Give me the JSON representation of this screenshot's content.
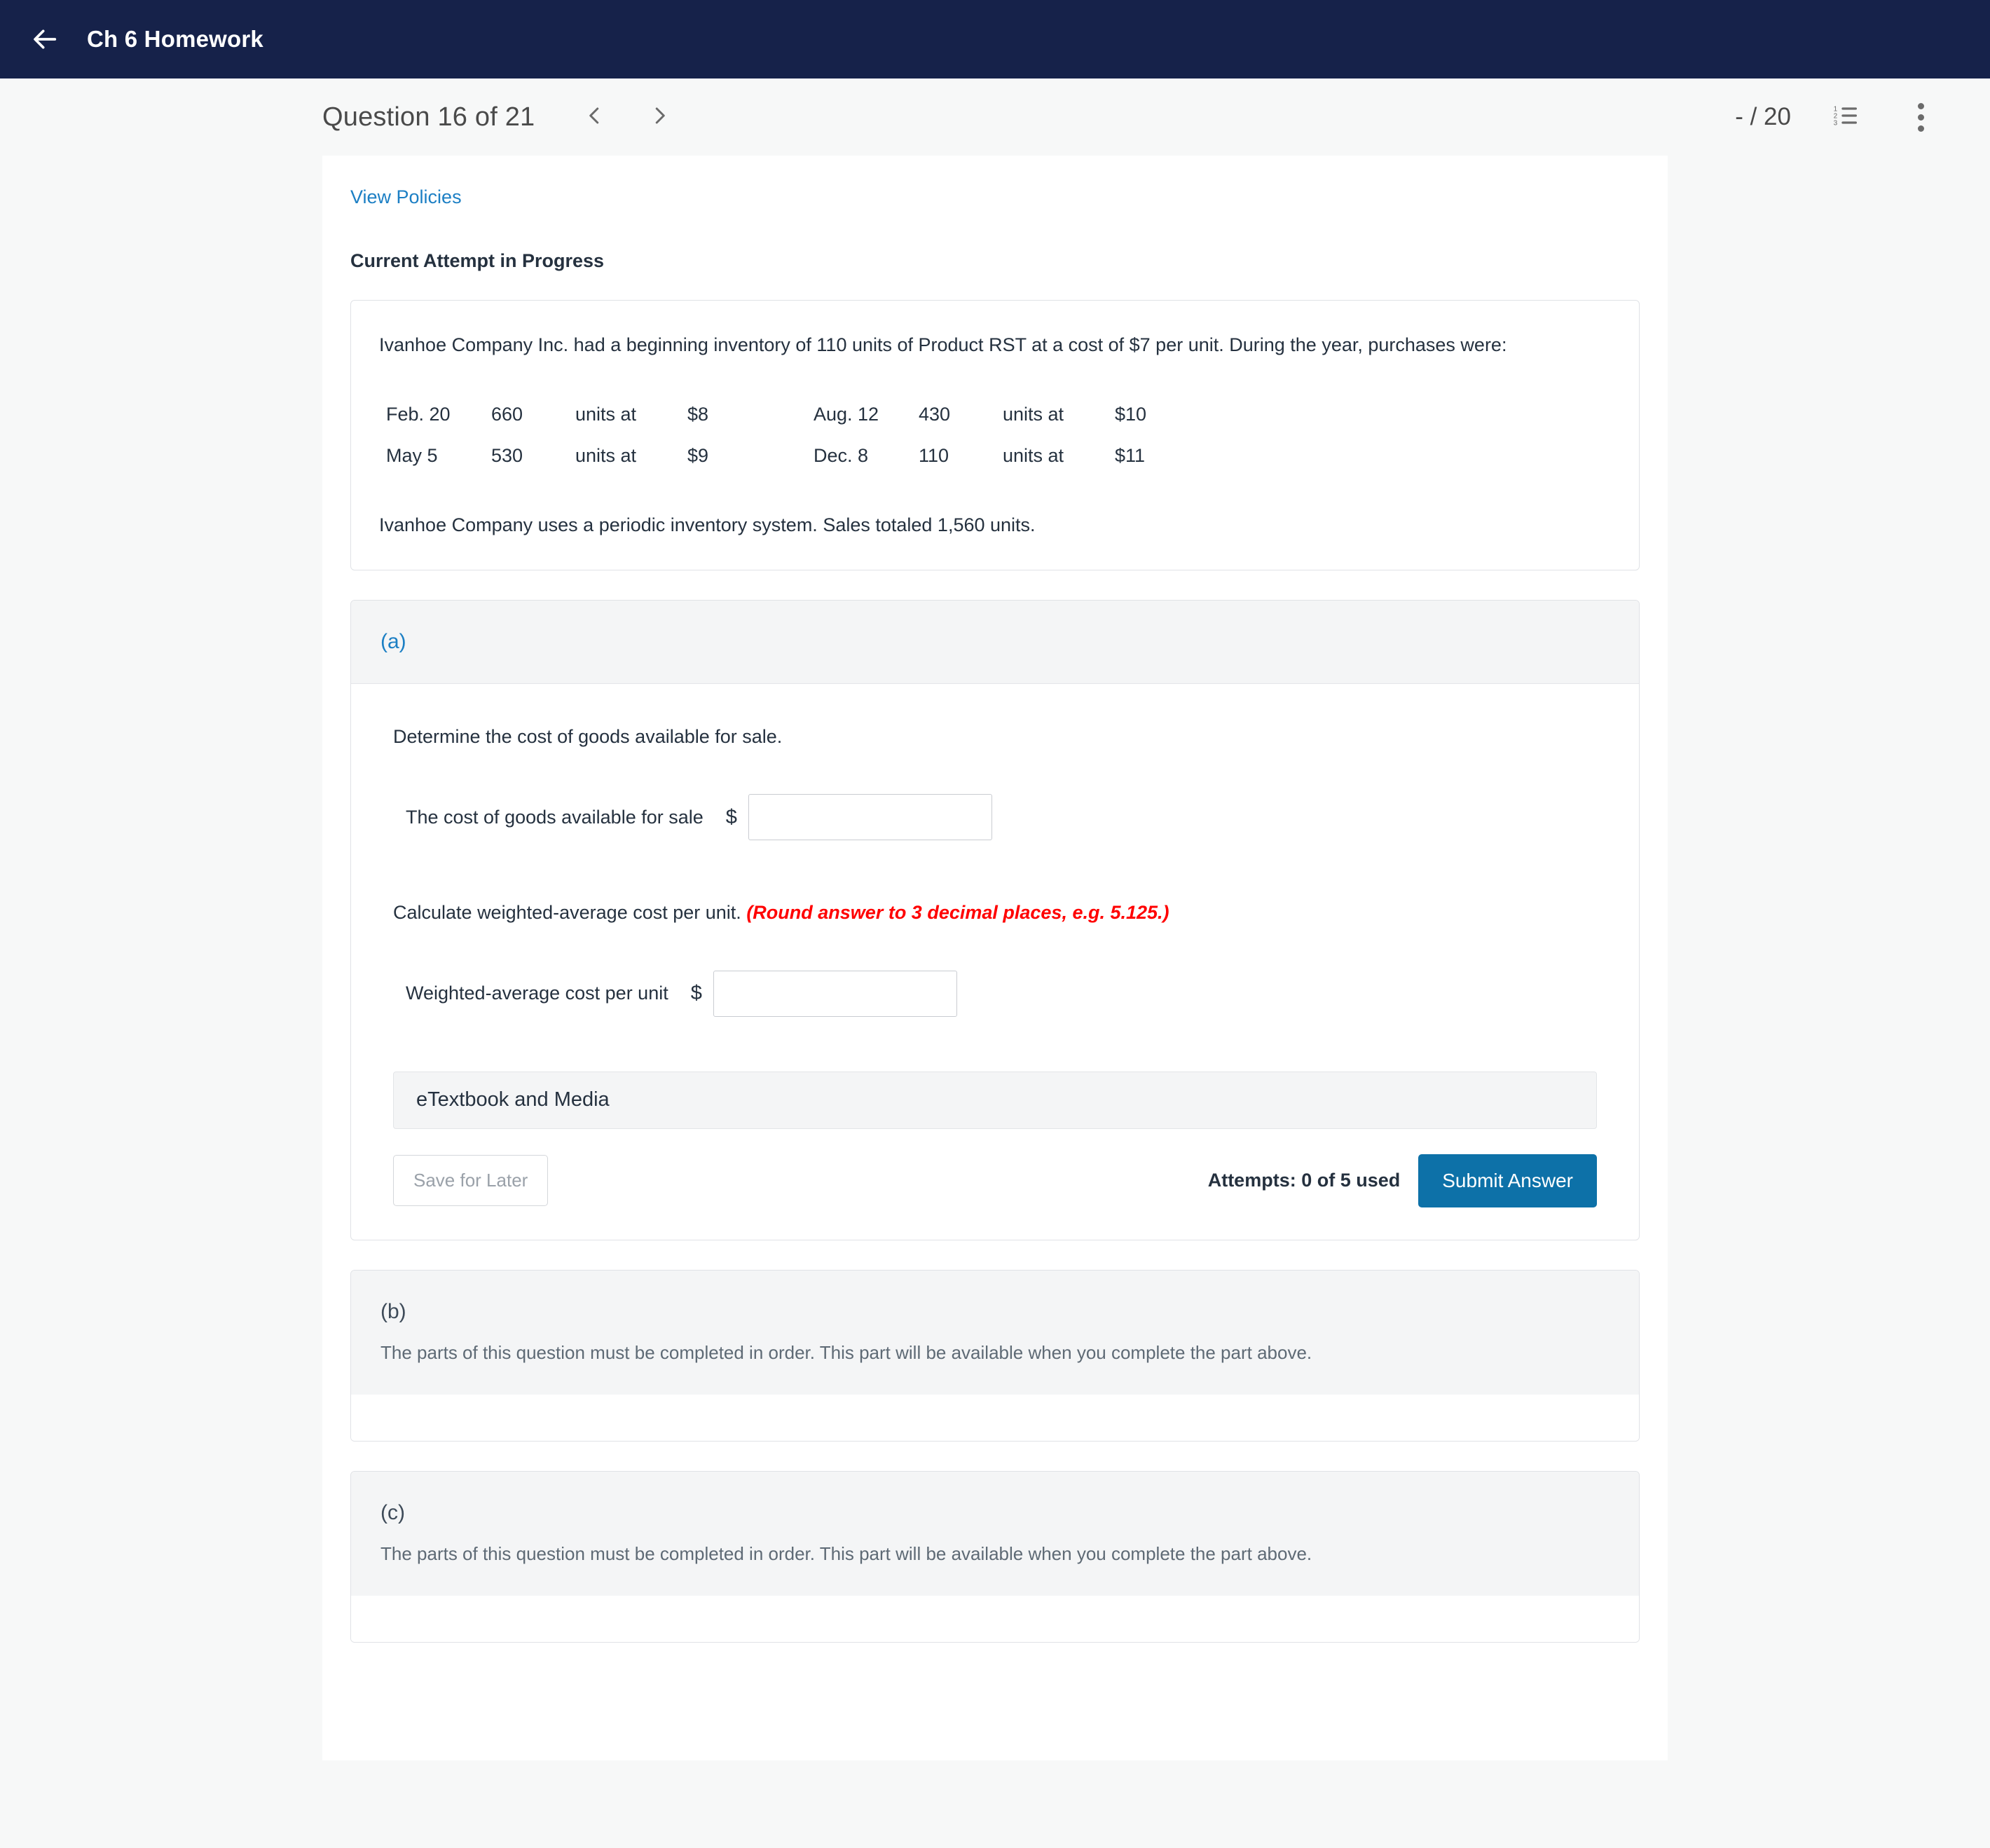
{
  "topbar": {
    "back_icon": "arrow-left-icon",
    "title": "Ch 6 Homework"
  },
  "question_header": {
    "title": "Question 16 of 21",
    "prev_icon": "chevron-left-icon",
    "next_icon": "chevron-right-icon",
    "score": "- / 20",
    "list_icon": "numbered-list-icon",
    "more_icon": "more-vertical-icon"
  },
  "content": {
    "view_policies": "View Policies",
    "attempt_status": "Current Attempt in Progress",
    "intro": "Ivanhoe Company Inc. had a beginning inventory of 110 units of Product RST at a cost of $7 per unit. During the year, purchases were:",
    "closing": "Ivanhoe Company uses a periodic inventory system. Sales totaled 1,560 units."
  },
  "purchases": {
    "rows": [
      {
        "left_date": "Feb. 20",
        "left_qty": "660",
        "left_at": "units at",
        "left_price": "$8",
        "right_date": "Aug. 12",
        "right_qty": "430",
        "right_at": "units at",
        "right_price": "$10"
      },
      {
        "left_date": "May 5",
        "left_qty": "530",
        "left_at": "units at",
        "left_price": "$9",
        "right_date": "Dec. 8",
        "right_qty": "110",
        "right_at": "units at",
        "right_price": "$11"
      }
    ]
  },
  "part_a": {
    "letter": "(a)",
    "prompt1": "Determine the cost of goods available for sale.",
    "cogs_label": "The cost of goods available for sale",
    "cogs_currency": "$",
    "cogs_value": "",
    "prompt2_plain": "Calculate weighted-average cost per unit.",
    "prompt2_red": "(Round answer to 3 decimal places, e.g. 5.125.)",
    "wavg_label": "Weighted-average cost per unit",
    "wavg_currency": "$",
    "wavg_value": "",
    "etextbook_label": "eTextbook and Media",
    "save_for_later": "Save for Later",
    "attempts": "Attempts: 0 of 5 used",
    "submit": "Submit Answer"
  },
  "part_b": {
    "letter": "(b)",
    "locked_message": "The parts of this question must be completed in order. This part will be available when you complete the part above."
  },
  "part_c": {
    "letter": "(c)",
    "locked_message": "The parts of this question must be completed in order. This part will be available when you complete the part above."
  },
  "colors": {
    "navbar": "#16224a",
    "link": "#1c7fc4",
    "submit": "#0d71a8",
    "warning": "#ff0000",
    "page_bg": "#f7f8f8"
  }
}
